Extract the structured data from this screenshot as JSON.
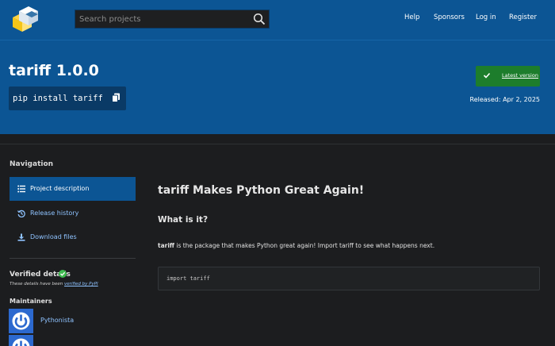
{
  "header": {
    "search_placeholder": "Search projects",
    "nav": {
      "help": "Help",
      "sponsors": "Sponsors",
      "login": "Log in",
      "register": "Register"
    }
  },
  "banner": {
    "title": "tariff 1.0.0",
    "pip_command": "pip install tariff",
    "latest_version_label": "Latest version",
    "released": "Released: Apr 2, 2025"
  },
  "sidebar": {
    "heading": "Navigation",
    "items": [
      {
        "label": "Project description",
        "icon": "list-icon",
        "active": true
      },
      {
        "label": "Release history",
        "icon": "history-icon",
        "active": false
      },
      {
        "label": "Download files",
        "icon": "download-icon",
        "active": false
      }
    ],
    "verified": {
      "title": "Verified details",
      "sub_prefix": "These details have been ",
      "sub_link": "verified by PyPI"
    },
    "maintainers": {
      "title": "Maintainers",
      "list": [
        {
          "name": "Pythonista"
        }
      ]
    }
  },
  "content": {
    "title": "tariff Makes Python Great Again!",
    "subheading": "What is it?",
    "paragraph_bold": "tariff",
    "paragraph_rest": " is the package that makes Python great again! Import tariff to see what happens next.",
    "code": "import tariff"
  },
  "colors": {
    "header_blue": "#0c5594",
    "latest_green": "#1d7d2c",
    "link_blue": "#8fc3ff",
    "background": "#1c1d1f"
  }
}
